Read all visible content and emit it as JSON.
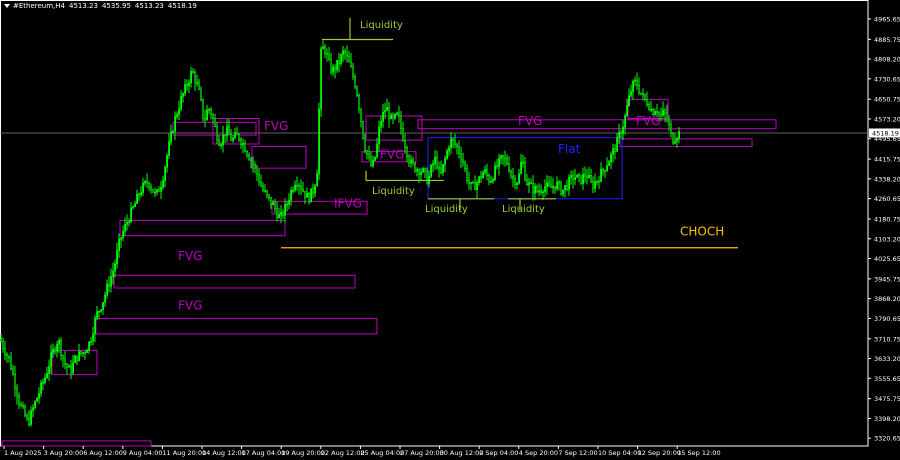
{
  "header": {
    "symbol": "#Ethereum,H4",
    "open": "4513.23",
    "high": "4535.95",
    "low": "4513.23",
    "close": "4518.19"
  },
  "chart_data": {
    "type": "candlestick",
    "ylim": [
      3290,
      5040
    ],
    "y_ticks": [
      3320.65,
      3398.2,
      3475.75,
      3555.65,
      3633.2,
      3710.75,
      3790.65,
      3868.2,
      3945.75,
      4025.65,
      4103.2,
      4180.75,
      4260.65,
      4338.2,
      4415.75,
      4495.65,
      4573.2,
      4650.75,
      4730.65,
      4808.2,
      4885.75,
      4965.65
    ],
    "current_price": 4518.19,
    "x_labels": [
      "1 Aug 2025",
      "3 Aug 20:00",
      "6 Aug 12:00",
      "9 Aug 04:00",
      "11 Aug 20:00",
      "14 Aug 12:00",
      "17 Aug 04:00",
      "19 Aug 20:00",
      "22 Aug 12:00",
      "25 Aug 04:00",
      "27 Aug 20:00",
      "30 Aug 12:00",
      "2 Sep 04:00",
      "4 Sep 20:00",
      "7 Sep 12:00",
      "10 Sep 04:00",
      "12 Sep 20:00",
      "15 Sep 12:00"
    ],
    "colors": {
      "bull": "#00ff00",
      "bear": "#00ff00",
      "fvg": "#c000c0",
      "liquidity": "#9acd32",
      "flat": "#2020ff",
      "choch": "#ffc000",
      "axis": "#ffffff",
      "price_line": "#808080"
    },
    "path_anchors": [
      [
        0,
        3710
      ],
      [
        10,
        3620
      ],
      [
        20,
        3450
      ],
      [
        28,
        3380
      ],
      [
        36,
        3470
      ],
      [
        45,
        3560
      ],
      [
        52,
        3650
      ],
      [
        58,
        3710
      ],
      [
        64,
        3620
      ],
      [
        70,
        3580
      ],
      [
        76,
        3640
      ],
      [
        84,
        3660
      ],
      [
        90,
        3700
      ],
      [
        96,
        3800
      ],
      [
        102,
        3850
      ],
      [
        108,
        3920
      ],
      [
        114,
        3990
      ],
      [
        120,
        4100
      ],
      [
        128,
        4180
      ],
      [
        134,
        4230
      ],
      [
        140,
        4290
      ],
      [
        148,
        4330
      ],
      [
        156,
        4270
      ],
      [
        162,
        4330
      ],
      [
        168,
        4450
      ],
      [
        174,
        4560
      ],
      [
        180,
        4640
      ],
      [
        186,
        4700
      ],
      [
        192,
        4760
      ],
      [
        196,
        4720
      ],
      [
        200,
        4660
      ],
      [
        204,
        4560
      ],
      [
        208,
        4620
      ],
      [
        212,
        4590
      ],
      [
        216,
        4520
      ],
      [
        220,
        4480
      ],
      [
        226,
        4530
      ],
      [
        232,
        4490
      ],
      [
        238,
        4510
      ],
      [
        244,
        4470
      ],
      [
        250,
        4420
      ],
      [
        256,
        4370
      ],
      [
        262,
        4300
      ],
      [
        268,
        4260
      ],
      [
        274,
        4230
      ],
      [
        280,
        4180
      ],
      [
        286,
        4230
      ],
      [
        290,
        4280
      ],
      [
        296,
        4340
      ],
      [
        302,
        4300
      ],
      [
        308,
        4260
      ],
      [
        314,
        4300
      ],
      [
        318,
        4400
      ],
      [
        320,
        4820
      ],
      [
        324,
        4860
      ],
      [
        328,
        4800
      ],
      [
        332,
        4760
      ],
      [
        338,
        4790
      ],
      [
        344,
        4840
      ],
      [
        350,
        4780
      ],
      [
        356,
        4700
      ],
      [
        360,
        4600
      ],
      [
        364,
        4480
      ],
      [
        368,
        4420
      ],
      [
        372,
        4380
      ],
      [
        376,
        4440
      ],
      [
        380,
        4560
      ],
      [
        386,
        4620
      ],
      [
        392,
        4560
      ],
      [
        398,
        4590
      ],
      [
        402,
        4520
      ],
      [
        406,
        4460
      ],
      [
        410,
        4400
      ],
      [
        416,
        4380
      ],
      [
        422,
        4370
      ],
      [
        428,
        4330
      ],
      [
        432,
        4390
      ],
      [
        436,
        4420
      ],
      [
        440,
        4340
      ],
      [
        446,
        4430
      ],
      [
        450,
        4490
      ],
      [
        456,
        4470
      ],
      [
        462,
        4420
      ],
      [
        468,
        4330
      ],
      [
        472,
        4300
      ],
      [
        478,
        4330
      ],
      [
        484,
        4370
      ],
      [
        490,
        4330
      ],
      [
        496,
        4380
      ],
      [
        502,
        4420
      ],
      [
        508,
        4400
      ],
      [
        512,
        4340
      ],
      [
        518,
        4330
      ],
      [
        522,
        4420
      ],
      [
        526,
        4330
      ],
      [
        532,
        4300
      ],
      [
        538,
        4290
      ],
      [
        544,
        4310
      ],
      [
        550,
        4300
      ],
      [
        556,
        4320
      ],
      [
        562,
        4290
      ],
      [
        568,
        4320
      ],
      [
        574,
        4350
      ],
      [
        580,
        4330
      ],
      [
        586,
        4360
      ],
      [
        592,
        4310
      ],
      [
        598,
        4340
      ],
      [
        604,
        4380
      ],
      [
        610,
        4420
      ],
      [
        616,
        4470
      ],
      [
        620,
        4520
      ],
      [
        624,
        4560
      ],
      [
        628,
        4640
      ],
      [
        632,
        4700
      ],
      [
        636,
        4720
      ],
      [
        640,
        4680
      ],
      [
        644,
        4650
      ],
      [
        648,
        4640
      ],
      [
        652,
        4600
      ],
      [
        656,
        4620
      ],
      [
        660,
        4580
      ],
      [
        664,
        4600
      ],
      [
        668,
        4560
      ],
      [
        672,
        4490
      ],
      [
        676,
        4510
      ],
      [
        680,
        4520
      ]
    ],
    "zones": [
      {
        "kind": "fvg",
        "x0": 2,
        "x1": 151,
        "y0": 3310,
        "y1": 3290
      },
      {
        "kind": "fvg",
        "x0": 52,
        "x1": 97,
        "y0": 3665,
        "y1": 3570
      },
      {
        "kind": "fvg",
        "x0": 96,
        "x1": 377,
        "y0": 3790,
        "y1": 3730
      },
      {
        "kind": "fvg",
        "x0": 114,
        "x1": 355,
        "y0": 3960,
        "y1": 3910
      },
      {
        "kind": "fvg",
        "x0": 120,
        "x1": 285,
        "y0": 4175,
        "y1": 4115
      },
      {
        "kind": "fvg",
        "x0": 173,
        "x1": 256,
        "y0": 4560,
        "y1": 4510
      },
      {
        "kind": "fvg",
        "x0": 213,
        "x1": 259,
        "y0": 4575,
        "y1": 4475
      },
      {
        "kind": "fvg",
        "x0": 252,
        "x1": 306,
        "y0": 4465,
        "y1": 4380
      },
      {
        "kind": "fvg",
        "x0": 272,
        "x1": 367,
        "y0": 4250,
        "y1": 4200
      },
      {
        "kind": "fvg",
        "x0": 366,
        "x1": 422,
        "y0": 4585,
        "y1": 4490
      },
      {
        "kind": "fvg",
        "x0": 362,
        "x1": 416,
        "y0": 4445,
        "y1": 4405
      },
      {
        "kind": "fvg",
        "x0": 418,
        "x1": 776,
        "y0": 4570,
        "y1": 4535
      },
      {
        "kind": "fvg",
        "x0": 628,
        "x1": 668,
        "y0": 4650,
        "y1": 4575
      },
      {
        "kind": "fvg",
        "x0": 620,
        "x1": 752,
        "y0": 4495,
        "y1": 4465
      },
      {
        "kind": "flat",
        "x0": 428,
        "x1": 622,
        "y0": 4500,
        "y1": 4260
      }
    ],
    "liquidity_lines": [
      {
        "x0": 322,
        "x1": 393,
        "y": 4885,
        "tick_x": 350,
        "tick_to": 4970
      },
      {
        "x0": 366,
        "x1": 444,
        "y": 4332,
        "tick_x": 366,
        "tick_to": 4370
      },
      {
        "x0": 428,
        "x1": 494,
        "y": 4260,
        "tick_x": 460,
        "tick_to": 4215
      },
      {
        "x0": 508,
        "x1": 556,
        "y": 4260,
        "tick_x": 520,
        "tick_to": 4215
      }
    ],
    "choch_line": {
      "x0": 281,
      "x1": 738,
      "y": 4068
    },
    "annotations": [
      {
        "text": "Liquidity",
        "x": 360,
        "y": 4930,
        "color": "liquidity"
      },
      {
        "text": "FVG",
        "x": 264,
        "y": 4530,
        "color": "fvg"
      },
      {
        "text": "FVG",
        "x": 518,
        "y": 4550,
        "color": "fvg"
      },
      {
        "text": "FVG",
        "x": 636,
        "y": 4550,
        "color": "fvg"
      },
      {
        "text": "FVG",
        "x": 380,
        "y": 4418,
        "color": "fvg"
      },
      {
        "text": "Flat",
        "x": 558,
        "y": 4440,
        "color": "flat"
      },
      {
        "text": "IFVG",
        "x": 334,
        "y": 4225,
        "color": "fvg"
      },
      {
        "text": "Liquidity",
        "x": 372,
        "y": 4278,
        "color": "liquidity"
      },
      {
        "text": "Liquidity",
        "x": 425,
        "y": 4208,
        "color": "liquidity"
      },
      {
        "text": "Liquidity",
        "x": 502,
        "y": 4208,
        "color": "liquidity"
      },
      {
        "text": "CHOCH",
        "x": 680,
        "y": 4115,
        "color": "choch"
      },
      {
        "text": "FVG",
        "x": 178,
        "y": 4020,
        "color": "fvg"
      },
      {
        "text": "FVG",
        "x": 178,
        "y": 3825,
        "color": "fvg"
      }
    ]
  }
}
